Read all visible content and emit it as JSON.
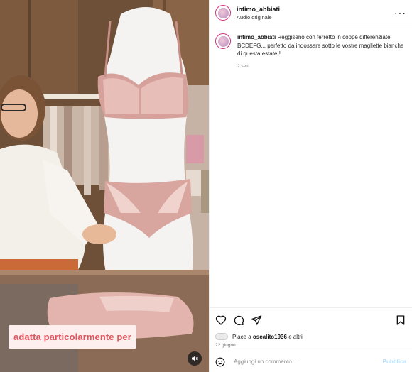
{
  "media": {
    "caption": "adatta particolarmente per",
    "mute_icon": "speaker-muted-icon"
  },
  "post": {
    "username": "intimo_abbiati",
    "audio": "Audio originale",
    "more_icon": "more-dots-icon"
  },
  "comment": {
    "username": "intimo_abbiati",
    "text": "Reggiseno con ferretto in coppe differenziate BCDEFG... perfetto da indossare sotto le vostre magliette bianche di questa estate !",
    "time": "2 sett"
  },
  "actions": {
    "icons": [
      "heart-icon",
      "comment-icon",
      "share-icon",
      "bookmark-icon"
    ]
  },
  "likes": {
    "prefix": "Piace a",
    "user": "oscalito1936",
    "suffix": "e altri",
    "date": "22 giugno"
  },
  "add_comment": {
    "placeholder": "Aggiungi un commento...",
    "publish": "Pubblica"
  },
  "colors": {
    "caption_bg": "#fcefee",
    "caption_text": "#e0565f",
    "publish": "#b2dffc",
    "ring": "#d42e7a"
  }
}
